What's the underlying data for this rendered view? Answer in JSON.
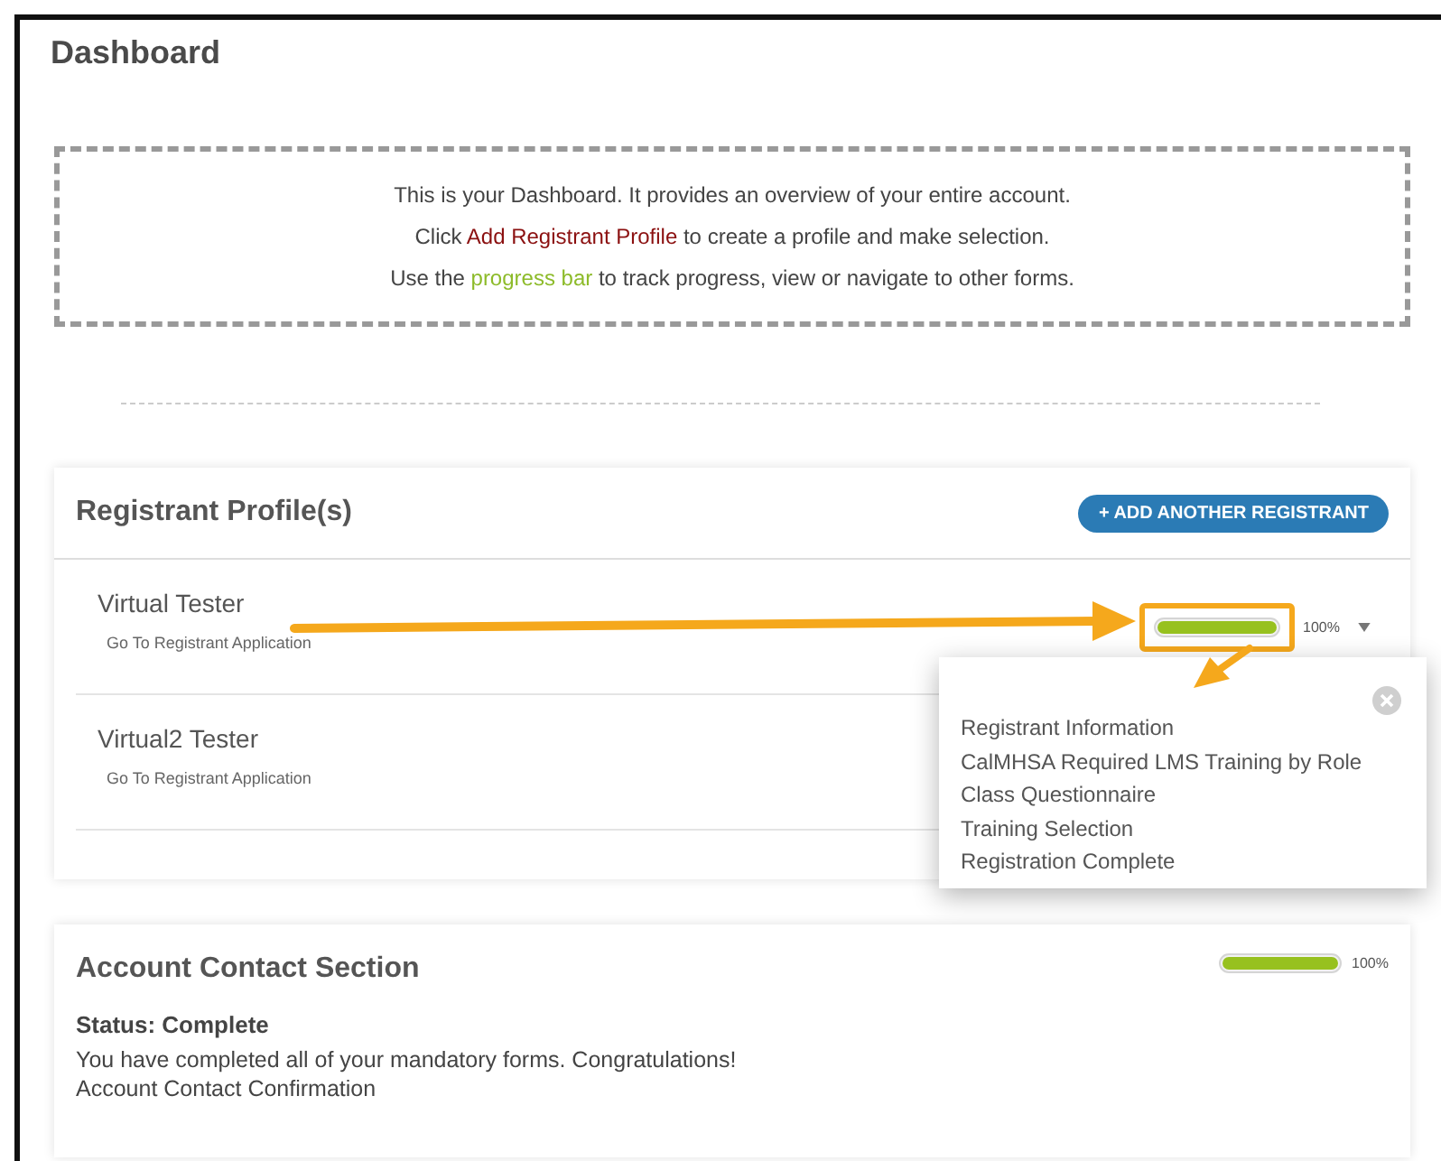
{
  "page": {
    "title": "Dashboard"
  },
  "info_box": {
    "lines": [
      {
        "parts": [
          {
            "kind": "text",
            "text": "This is your Dashboard. It provides an overview of your entire account."
          }
        ]
      },
      {
        "parts": [
          {
            "kind": "text",
            "text": "Click "
          },
          {
            "kind": "link",
            "text": "Add Registrant Profile"
          },
          {
            "kind": "text",
            "text": " to create a profile and make selection."
          }
        ]
      },
      {
        "parts": [
          {
            "kind": "text",
            "text": "Use the "
          },
          {
            "kind": "highlight",
            "text": "progress bar"
          },
          {
            "kind": "text",
            "text": " to track progress, view or navigate to other forms."
          }
        ]
      }
    ]
  },
  "registrants": {
    "title": "Registrant Profile(s)",
    "add_button": "+ ADD ANOTHER REGISTRANT",
    "rows": [
      {
        "name": "Virtual Tester",
        "link": "Go To Registrant Application",
        "progress": {
          "level": 1,
          "reading": "100%",
          "highlighted": true,
          "expanded": true
        }
      },
      {
        "name": "Virtual2 Tester",
        "link": "Go To Registrant Application"
      }
    ],
    "popup": {
      "items": [
        "Registrant Information",
        "CalMHSA Required LMS Training by Role",
        "Class Questionnaire",
        "Training Selection",
        "Registration Complete"
      ]
    }
  },
  "account_contact": {
    "title": "Account Contact Section",
    "level": 1,
    "reading": "100%",
    "status": "Status: Complete",
    "message": "You have completed all of your mandatory forms. Congratulations!",
    "link": "Account Contact Confirmation"
  }
}
